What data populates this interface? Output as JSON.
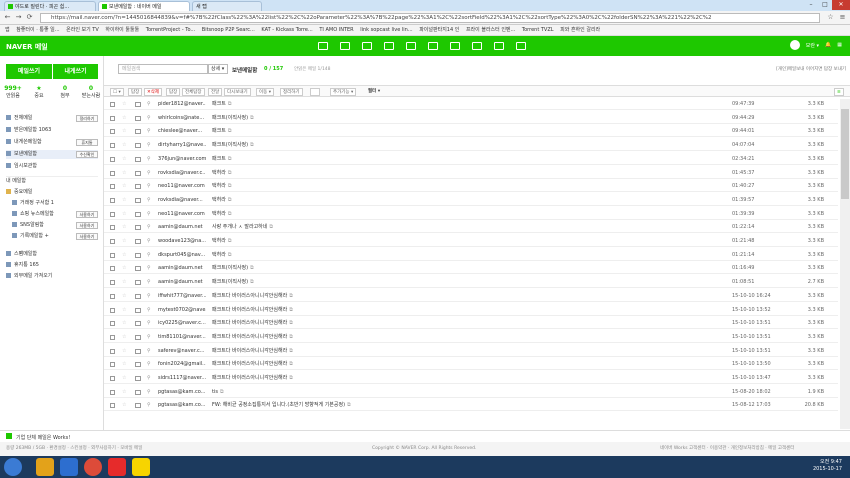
{
  "browser": {
    "tabs": [
      "야드로 질린다 · 피곤 쉽...",
      "보낸메일함 : 네이버 메일",
      "새 탭"
    ],
    "url": "https://mail.naver.com/?n=1445016844839&v=f#%7B%22fClass%22%3A%22list%22%2C%22oParameter%22%3A%7B%22page%22%3A1%2C%22sortField%22%3A1%2C%22sortType%22%3A0%2C%22folderSN%22%3A%221%22%2C%2",
    "bookmarks": [
      "앱",
      "참좋터이 · 통좋 일...",
      "온라인 보기 TV",
      "하이하이 툴툴툴",
      "TorrentProject - To...",
      "Bitsnoop P2P Searc...",
      "KAT - Kickass Torre...",
      "TI AMO INTER",
      "link sopcast live lin...",
      "파이널판타지14 인",
      "프라이 블라스터 인벤...",
      "Torrent TVZL",
      "피와 흔하인 갈리라"
    ]
  },
  "gnb": {
    "logo": "NAVER 메일",
    "user": "모란 ▾",
    "badge": "3"
  },
  "sidebar": {
    "write": "메일쓰기",
    "self": "내게쓰기",
    "stats": [
      {
        "n": "999+",
        "l": "안읽음"
      },
      {
        "n": "★",
        "l": "중요"
      },
      {
        "n": "0",
        "l": "첨부"
      },
      {
        "n": "0",
        "l": "받는사람"
      }
    ],
    "folders": [
      {
        "label": "전체메일",
        "btn": "정리하기"
      },
      {
        "label": "받은메일함 1063",
        "btn": ""
      },
      {
        "label": "내게쓴메일함",
        "btn": "휴지통"
      },
      {
        "label": "보낸메일함",
        "btn": "수신확인"
      },
      {
        "label": "임시보관함",
        "btn": ""
      }
    ],
    "my_title": "내 메일함",
    "my": [
      {
        "label": "중요메일",
        "btn": ""
      },
      {
        "label": "거래정 구서함 1",
        "btn": ""
      },
      {
        "label": "쇼핑 뉴스메일함",
        "btn": "사용하기"
      },
      {
        "label": "SNS알림함",
        "btn": "사용하기"
      },
      {
        "label": "기록메일함 +",
        "btn": "사용하기"
      }
    ],
    "extra": [
      "스팸메일함",
      "휴지통 165",
      "외부메일 가져오기"
    ],
    "banner": "기업 단체 메일은 Works!"
  },
  "main": {
    "search_placeholder": "메일검색",
    "search_opt": "상세 ▾",
    "folder": "보낸메일함",
    "count": "0 / 157",
    "unread": "안읽은 메일 1/148",
    "storage": "[개인]메일보내 이어지면 답장 보내기",
    "toolbar": [
      "답장",
      "✕삭제",
      "답장",
      "전체답장",
      "전달",
      "다시보내기",
      "이동 ▾",
      "정리하기",
      "",
      "추가기능 ▾",
      "필터 ▾"
    ],
    "rows": [
      {
        "s": "pider1812@naver...",
        "t": "패크트",
        "d": "09:47:39",
        "z": "3.3 KB"
      },
      {
        "s": "whirlcoins@nate...",
        "t": "패크트(이직사정)",
        "d": "09:44:29",
        "z": "3.3 KB"
      },
      {
        "s": "chieslee@naver...",
        "t": "패크트",
        "d": "09:44:01",
        "z": "3.3 KB"
      },
      {
        "s": "dirtyharry1@nave...",
        "t": "패크트(이직사정)",
        "d": "04:07:04",
        "z": "3.3 KB"
      },
      {
        "s": "376jun@naver.com",
        "t": "패크트",
        "d": "02:34:21",
        "z": "3.3 KB"
      },
      {
        "s": "rovksdia@naver.c...",
        "t": "택허라",
        "d": "01:45:37",
        "z": "3.3 KB"
      },
      {
        "s": "neo11@naver.com",
        "t": "택허라",
        "d": "01:40:27",
        "z": "3.3 KB"
      },
      {
        "s": "rovksdia@naver...",
        "t": "택허라",
        "d": "01:39:57",
        "z": "3.3 KB"
      },
      {
        "s": "neo11@naver.com",
        "t": "택허라",
        "d": "01:39:39",
        "z": "3.3 KB"
      },
      {
        "s": "aamin@daum.net",
        "t": "사랑 주개나 ㅅ 말라고하네",
        "d": "01:22:14",
        "z": "3.3 KB"
      },
      {
        "s": "woodave123@na...",
        "t": "택허라",
        "d": "01:21:48",
        "z": "3.3 KB"
      },
      {
        "s": "dkspurt045@nav...",
        "t": "택허라",
        "d": "01:21:14",
        "z": "3.3 KB"
      },
      {
        "s": "aamin@daum.net",
        "t": "패크트(이직사정)",
        "d": "01:16:49",
        "z": "3.3 KB"
      },
      {
        "s": "aamin@daum.net",
        "t": "패크트(이직사정)",
        "d": "01:08:51",
        "z": "2.7 KB"
      },
      {
        "s": "iffwhit777@naver...",
        "t": "패크트다 바이러스아니니각안심해라",
        "d": "15-10-10 16:24",
        "z": "3.3 KB"
      },
      {
        "s": "mytest0702@nave...",
        "t": "패크트다 바이러스아니니각안심해라",
        "d": "15-10-10 13:52",
        "z": "3.3 KB"
      },
      {
        "s": "icy0225@naver.c...",
        "t": "패크트다 바이러스아니니각안심해라",
        "d": "15-10-10 13:51",
        "z": "3.3 KB"
      },
      {
        "s": "tim81101@naver...",
        "t": "패크트다 바이러스아니니각안심해라",
        "d": "15-10-10 13:51",
        "z": "3.3 KB"
      },
      {
        "s": "saferev@naver.c...",
        "t": "패크트다 바이러스아니니각안심해라",
        "d": "15-10-10 13:51",
        "z": "3.3 KB"
      },
      {
        "s": "fonin2024@gmail...",
        "t": "패크트다 바이러스아니니각안심해라",
        "d": "15-10-10 13:50",
        "z": "3.3 KB"
      },
      {
        "s": "sidrs1117@naver...",
        "t": "패크트다 바이러스아니니각안심해라",
        "d": "15-10-10 13:47",
        "z": "3.3 KB"
      },
      {
        "s": "pgtasas@kam.co...",
        "t": "tis",
        "d": "15-08-20 18:02",
        "z": "1.9 KB"
      },
      {
        "s": "pgtasas@kam.co...",
        "t": "FW: 해비균 공정소집통지서 입니다.(초반기 방향적게 기본공정)",
        "d": "15-08-12 17:03",
        "z": "20.8 KB"
      }
    ],
    "pager": [
      "«",
      "‹",
      "1",
      "2",
      "›",
      "»"
    ]
  },
  "footer": {
    "left": "용량 263MB / 5GB · 환경설정 · 스킨설정 · 외부사용하기 · 모바일 메일",
    "center": "Copyright © NAVER Corp. All Rights Reserved.",
    "right": "네이버 Works 고객센터 · 이용약관 · 개인정보처리방침 · 메일 고객센터"
  },
  "taskbar": {
    "time": "오전 9:47",
    "date": "2015-10-17"
  }
}
